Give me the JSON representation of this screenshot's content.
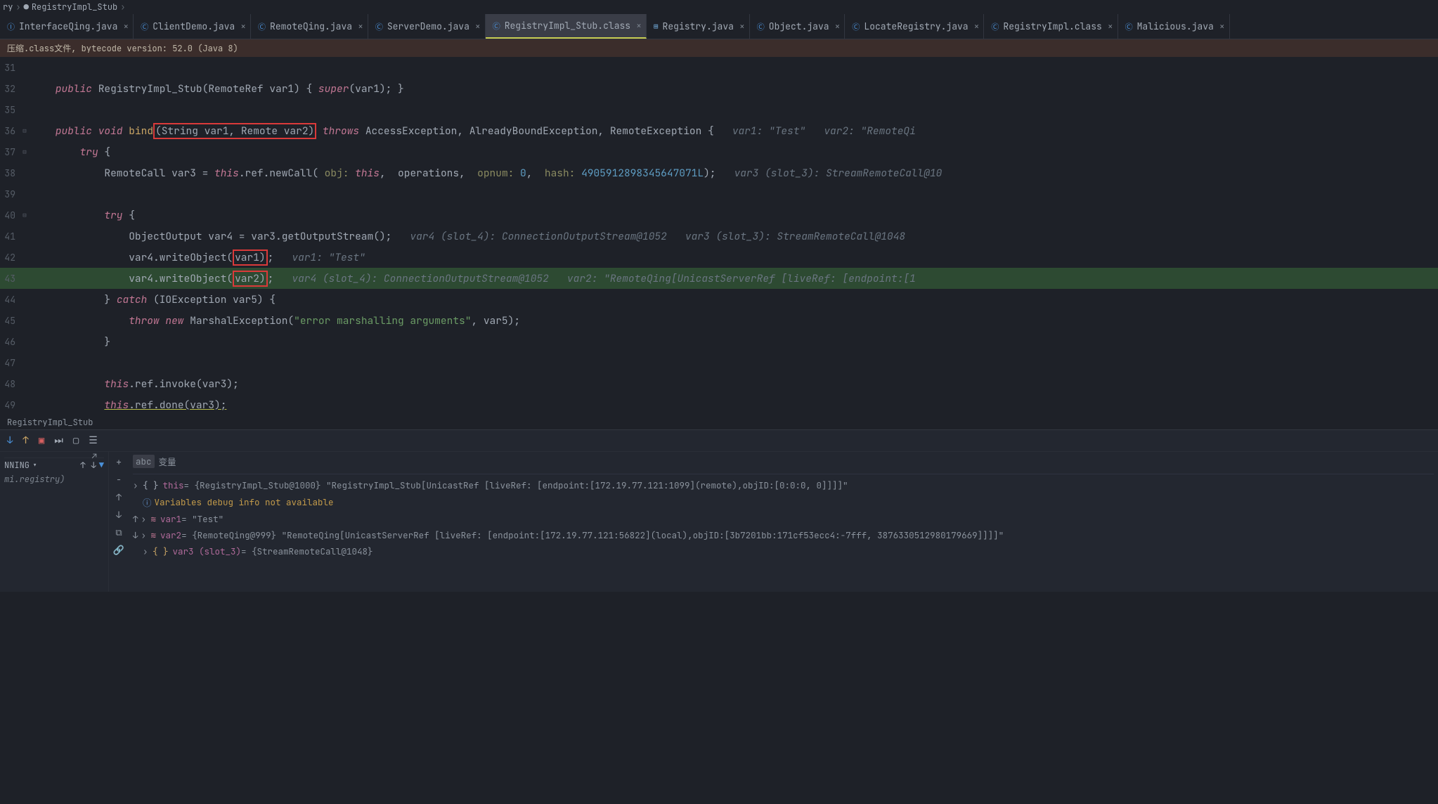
{
  "breadcrumb": {
    "p1": "ry",
    "p2": "RegistryImpl_Stub"
  },
  "tabs": [
    {
      "label": "InterfaceQing.java",
      "icon": "ji",
      "type": "java"
    },
    {
      "label": "ClientDemo.java",
      "icon": "ci",
      "type": "class"
    },
    {
      "label": "RemoteQing.java",
      "icon": "ci",
      "type": "class"
    },
    {
      "label": "ServerDemo.java",
      "icon": "ci",
      "type": "class"
    },
    {
      "label": "RegistryImpl_Stub.class",
      "icon": "ci",
      "type": "class",
      "active": true
    },
    {
      "label": "Registry.java",
      "icon": "li",
      "type": "iface"
    },
    {
      "label": "Object.java",
      "icon": "ci",
      "type": "class"
    },
    {
      "label": "LocateRegistry.java",
      "icon": "ci",
      "type": "class"
    },
    {
      "label": "RegistryImpl.class",
      "icon": "ci",
      "type": "class"
    },
    {
      "label": "Malicious.java",
      "icon": "ci",
      "type": "class"
    }
  ],
  "banner": "压缩.class文件, bytecode version: 52.0 (Java 8)",
  "gutters": [
    "31",
    "32",
    "35",
    "36",
    "37",
    "38",
    "39",
    "40",
    "41",
    "42",
    "43",
    "44",
    "45",
    "46",
    "47",
    "48",
    "49"
  ],
  "code": {
    "l32_kw": "public",
    "l32_t": " RegistryImpl_Stub(RemoteRef var1) { ",
    "l32_kw2": "super",
    "l32_t2": "(var1); }",
    "l36_kw": "public void",
    "l36_m": " bind",
    "l36_p": "(String var1, Remote var2)",
    "l36_kw2": " throws",
    "l36_t": " AccessException, AlreadyBoundException, RemoteException {   ",
    "l36_c": "var1: \"Test\"   var2: \"RemoteQi",
    "l37_kw": "try",
    "l37_t": " {",
    "l38_t1": "RemoteCall var3 = ",
    "l38_kw": "this",
    "l38_t2": ".ref.newCall( ",
    "l38_p1": "obj:",
    "l38_kw2": " this",
    "l38_t3": ",  operations,  ",
    "l38_p2": "opnum:",
    "l38_n1": " 0",
    "l38_t4": ",  ",
    "l38_p3": "hash:",
    "l38_n2": " 4905912898345647071L",
    "l38_t5": ");   ",
    "l38_c": "var3 (slot_3): StreamRemoteCall@10",
    "l40_kw": "try",
    "l40_t": " {",
    "l41_t": "ObjectOutput var4 = var3.getOutputStream();   ",
    "l41_c": "var4 (slot_4): ConnectionOutputStream@1052   var3 (slot_3): StreamRemoteCall@1048",
    "l42_t1": "var4.writeObject(",
    "l42_rb": "var1)",
    "l42_t2": ";   ",
    "l42_c": "var1: \"Test\"",
    "l43_t1": "var4.writeObject(",
    "l43_rb": "var2)",
    "l43_t2": ";   ",
    "l43_c": "var4 (slot_4): ConnectionOutputStream@1052   var2: \"RemoteQing[UnicastServerRef [liveRef: [endpoint:[1",
    "l44_t": "} ",
    "l44_kw": "catch",
    "l44_t2": " (IOException var5) {",
    "l45_kw": "throw new",
    "l45_t": " MarshalException(",
    "l45_s": "\"error marshalling arguments\"",
    "l45_t2": ", var5);",
    "l46_t": "}",
    "l48_kw": "this",
    "l48_t": ".ref.invoke(var3);",
    "l49_kw": "this",
    "l49_t": ".ref.done(var3);"
  },
  "crumb2": "RegistryImpl_Stub",
  "debug": {
    "side_running": "NNING",
    "side_registry": "mi.registry)",
    "vars_label": "变量",
    "this_label": "this",
    "this_val": " = {RegistryImpl_Stub@1000} \"RegistryImpl_Stub[UnicastRef [liveRef: [endpoint:[172.19.77.121:1099](remote),objID:[0:0:0, 0]]]]\"",
    "info_msg": "Variables debug info not available",
    "var1_label": "var1",
    "var1_val": " = \"Test\"",
    "var2_label": "var2",
    "var2_val": " = {RemoteQing@999} \"RemoteQing[UnicastServerRef [liveRef: [endpoint:[172.19.77.121:56822](local),objID:[3b7201bb:171cf53ecc4:-7fff, 3876330512980179669]]]]\"",
    "var3_label": "var3 (slot_3)",
    "var3_val": " = {StreamRemoteCall@1048}"
  }
}
